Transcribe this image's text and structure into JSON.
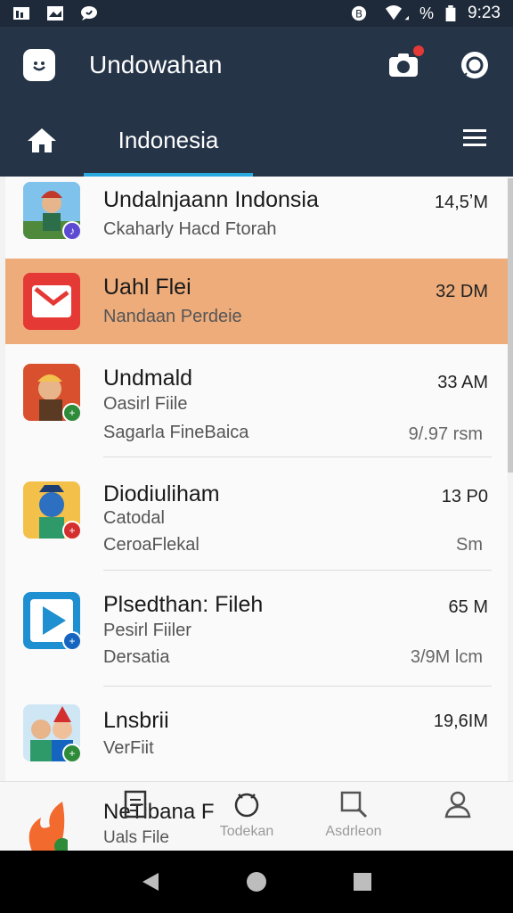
{
  "status_bar": {
    "time": "9:23",
    "percent_glyph": "%"
  },
  "appbar": {
    "title": "Undowahan",
    "tab": "Indonesia"
  },
  "list": [
    {
      "title": "Undalnjaann Indonsia",
      "sub": "Ckaharly Hacd Ftorah",
      "size": "14,5ʼM",
      "meta": "",
      "badge_color": "#5c4bd2",
      "badge_glyph": "♪"
    },
    {
      "title": "Uahl Flei",
      "sub": "Nandaan Perdeie",
      "size": "32 DM",
      "meta": "",
      "selected": true
    },
    {
      "title": "Undmald",
      "sub": "Oasirl Fiile",
      "sub2": "Sagarla FineBaica",
      "size": "33 AM",
      "meta": "9/.97 rsm",
      "badge_color": "#2e8b3a",
      "badge_glyph": "+"
    },
    {
      "title": "Diodiuliham",
      "sub": "Catodal",
      "sub2": "CeroaFlekal",
      "size": "13 P0",
      "meta": "Sm",
      "badge_color": "#d32f2f",
      "badge_glyph": "+"
    },
    {
      "title": "Plsedthan: Fileh",
      "sub": "Pesirl Fiiler",
      "sub2": "Dersatia",
      "size": "65 M",
      "meta": "3/9M lcm",
      "badge_color": "#1565c0",
      "badge_glyph": "+"
    },
    {
      "title": "Lnsbrii",
      "sub": "VerFiit",
      "size": "19,6IM",
      "meta": "",
      "badge_color": "#2e8b3a",
      "badge_glyph": "+"
    },
    {
      "title": "NeTibana F",
      "sub": "Uals File",
      "size": "",
      "meta": "",
      "badge_color": "#2e8b3a",
      "badge_glyph": "+"
    }
  ],
  "bottom_nav": [
    {
      "label": "",
      "icon": "document-icon"
    },
    {
      "label": "Todekan",
      "icon": "bell-icon"
    },
    {
      "label": "Asdrleon",
      "icon": "search-icon"
    },
    {
      "label": "",
      "icon": "person-icon"
    }
  ]
}
